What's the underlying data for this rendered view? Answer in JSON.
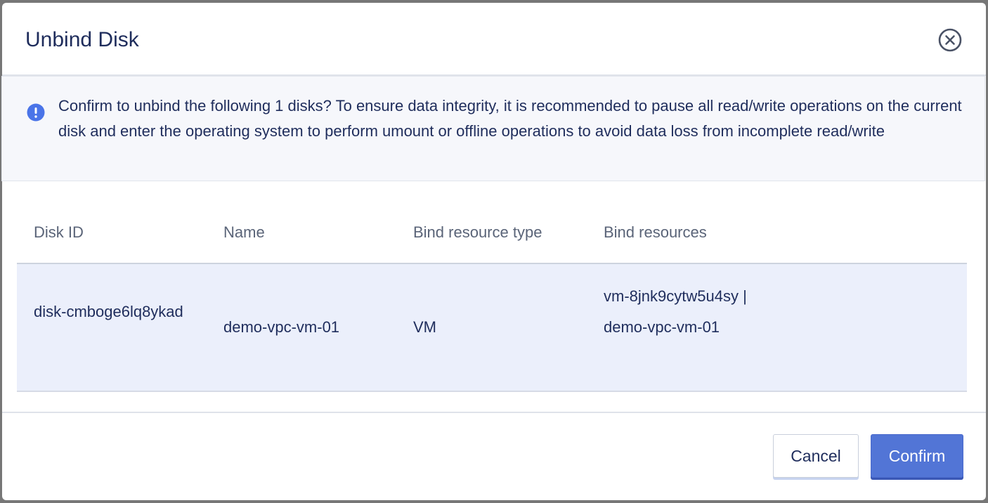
{
  "dialog": {
    "title": "Unbind Disk",
    "close_icon": "close-circle-icon"
  },
  "alert": {
    "icon": "info-exclamation-icon",
    "text": "Confirm to unbind the following 1 disks? To ensure data integrity, it is recommended to pause all read/write operations on the current disk and enter the operating system to perform umount or offline operations to avoid data loss from incomplete read/write"
  },
  "table": {
    "columns": [
      "Disk ID",
      "Name",
      "Bind resource type",
      "Bind resources"
    ],
    "rows": [
      {
        "disk_id": "disk-cmboge6lq8ykad",
        "name": "demo-vpc-vm-01",
        "bind_resource_type": "VM",
        "bind_resources": "vm-8jnk9cytw5u4sy | demo-vpc-vm-01"
      }
    ]
  },
  "footer": {
    "cancel_label": "Cancel",
    "confirm_label": "Confirm"
  },
  "colors": {
    "primary": "#5275d6",
    "alert_icon": "#4a74e8",
    "row_highlight": "#ebeffb"
  }
}
